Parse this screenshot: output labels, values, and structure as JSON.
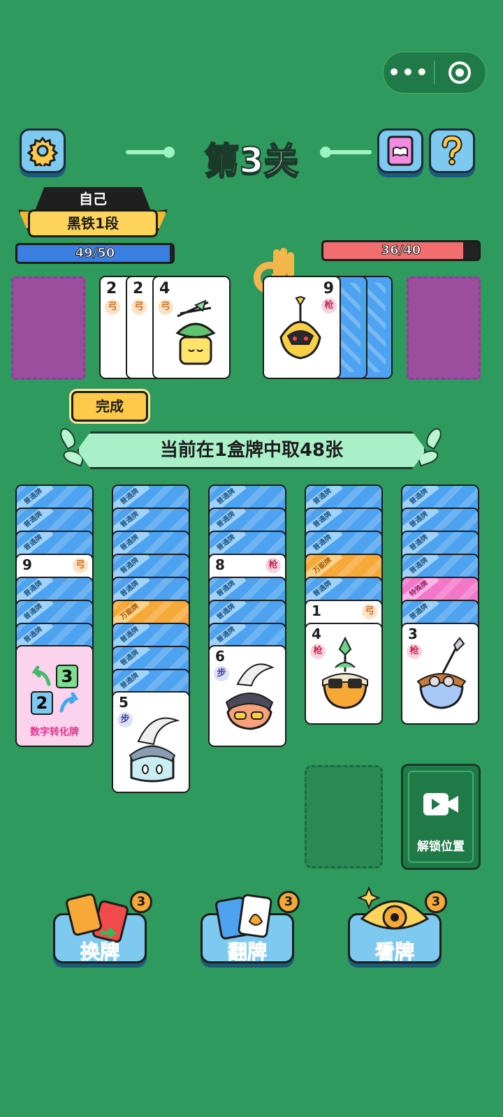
{
  "header": {
    "level_title": "第3关",
    "capsule_more": "•••"
  },
  "player": {
    "name": "自己",
    "rank": "黑铁1段",
    "hp_text": "49/50",
    "hp_fraction": 0.98,
    "hp_color": "#3a7fe0"
  },
  "opponent": {
    "hp_text": "36/40",
    "hp_fraction": 0.9,
    "hp_color": "#f26d6d"
  },
  "play_area": {
    "player_cards": [
      {
        "num": "2",
        "type": "弓"
      },
      {
        "num": "2",
        "type": "弓"
      },
      {
        "num": "4",
        "type": "弓"
      }
    ],
    "opponent_card": {
      "num": "9",
      "type": "枪"
    }
  },
  "done_button": "完成",
  "banner": "当前在1盒牌中取48张",
  "ribbons": {
    "normal": "普通牌",
    "wild": "万能牌",
    "special": "特殊牌"
  },
  "columns": [
    {
      "peek": {
        "num": "9",
        "type": "弓"
      },
      "face": {
        "special": true,
        "a": "3",
        "b": "2",
        "label": "数字转化牌"
      }
    },
    {
      "face": {
        "num": "5",
        "type": "步"
      }
    },
    {
      "peek": {
        "num": "8",
        "type": "枪"
      },
      "face": {
        "num": "6",
        "type": "步"
      }
    },
    {
      "peek": {
        "num": "1",
        "type": "弓"
      },
      "face": {
        "num": "4",
        "type": "枪"
      }
    },
    {
      "face": {
        "num": "3",
        "type": "枪"
      }
    }
  ],
  "unlock_label": "解锁位置",
  "powerups": [
    {
      "label": "换牌",
      "count": "3"
    },
    {
      "label": "翻牌",
      "count": "3"
    },
    {
      "label": "看牌",
      "count": "3"
    }
  ],
  "colors": {
    "background": "#2f9a5d",
    "card_back_normal": "#4ea3f0",
    "card_back_wild": "#f7a937",
    "card_back_special": "#f277c9"
  }
}
